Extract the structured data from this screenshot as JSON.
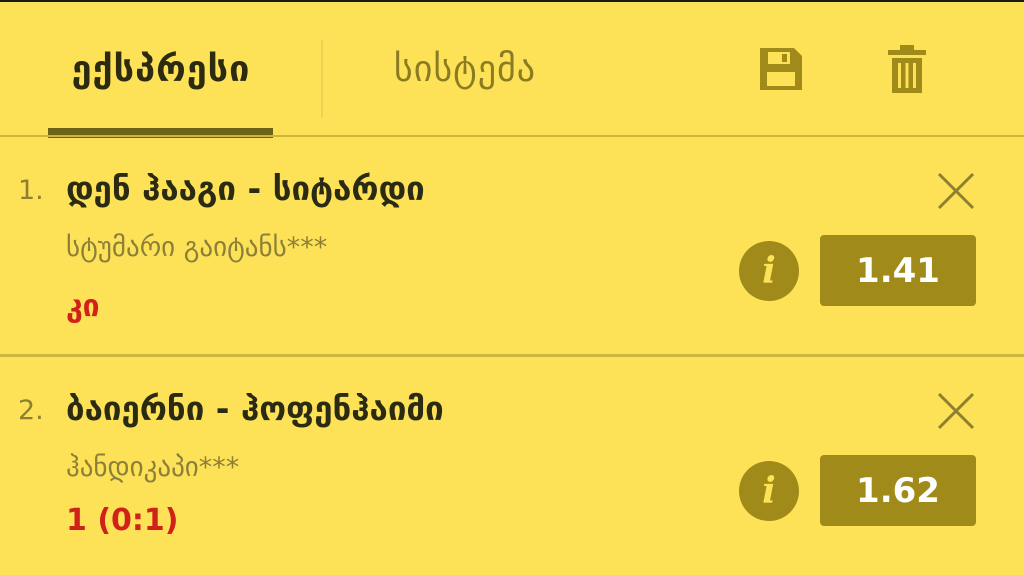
{
  "tabs": {
    "express_label": "ექსპრესი",
    "system_label": "სისტემა",
    "active": "express"
  },
  "toolbar": {
    "save_icon": "floppy-disk-icon",
    "trash_icon": "trash-icon"
  },
  "bets": [
    {
      "number": "1.",
      "match": "დენ ჰააგი - სიტარდი",
      "market": "სტუმარი გაიტანს***",
      "pick": "კი",
      "odds": "1.41"
    },
    {
      "number": "2.",
      "match": "ბაიერნი - ჰოფენჰაიმი",
      "market": "ჰანდიკაპი***",
      "pick": "1 (0:1)",
      "odds": "1.62"
    }
  ],
  "colors": {
    "background": "#fde257",
    "accent": "#a08b1a",
    "pick": "#d0211a",
    "active_tab_underline": "#6e6219"
  }
}
